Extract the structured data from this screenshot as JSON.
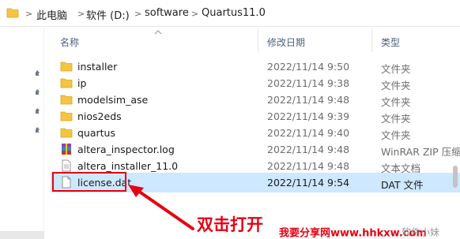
{
  "address": {
    "crumbs": [
      "此电脑",
      "软件 (D:)",
      "software",
      "Quartus11.0"
    ],
    "separator": ">"
  },
  "columns": {
    "name": "名称",
    "modified": "修改日期",
    "type": "类型"
  },
  "files": [
    {
      "name": "installer",
      "date": "2022/11/14 9:50",
      "type": "文件夹",
      "icon": "folder-icon"
    },
    {
      "name": "ip",
      "date": "2022/11/14 9:38",
      "type": "文件夹",
      "icon": "folder-icon"
    },
    {
      "name": "modelsim_ase",
      "date": "2022/11/14 9:48",
      "type": "文件夹",
      "icon": "folder-icon"
    },
    {
      "name": "nios2eds",
      "date": "2022/11/14 9:39",
      "type": "文件夹",
      "icon": "folder-icon"
    },
    {
      "name": "quartus",
      "date": "2022/11/14 9:40",
      "type": "文件夹",
      "icon": "folder-icon"
    },
    {
      "name": "altera_inspector.log",
      "date": "2022/11/14 9:48",
      "type": "WinRAR ZIP 压缩...",
      "icon": "winrar-archive-icon"
    },
    {
      "name": "altera_installer_11.0",
      "date": "2022/11/14 9:48",
      "type": "文本文档",
      "icon": "text-document-icon"
    },
    {
      "name": "license.dat",
      "date": "2022/11/14 9:54",
      "type": "DAT 文件",
      "icon": "blank-file-icon"
    }
  ],
  "annotation": "双击打开",
  "watermark": "我要分享网www.hhkxw.com",
  "watermark2": "软件小妹",
  "colors": {
    "selected_bg": "#cde8ff",
    "annotation": "#e60012",
    "folder": "#f5c542"
  }
}
